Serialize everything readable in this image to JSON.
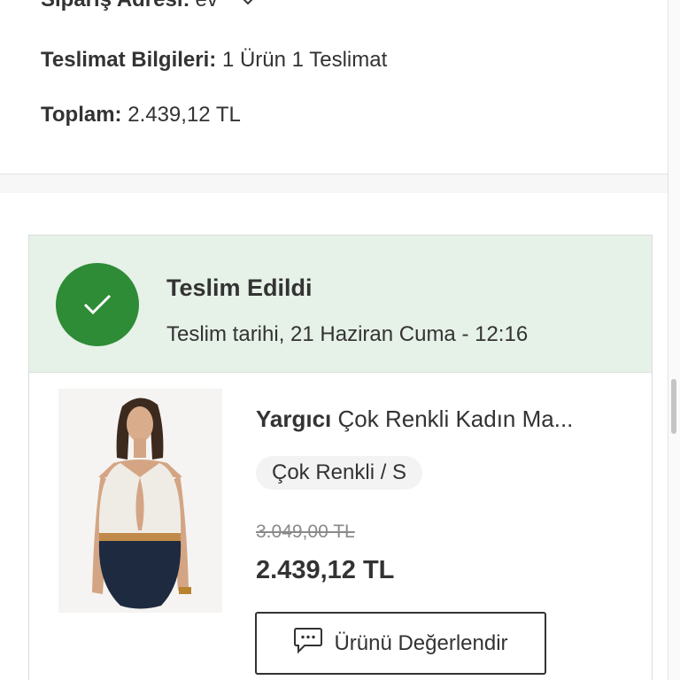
{
  "summary": {
    "address_label": "Sipariş Adresi:",
    "address_value": "ev",
    "address_toggle_icon": "chevron-down-icon",
    "delivery_label": "Teslimat Bilgileri:",
    "delivery_value": "1 Ürün 1 Teslimat",
    "total_label": "Toplam:",
    "total_value": "2.439,12 TL"
  },
  "shipment": {
    "status_icon": "check-icon",
    "status_color": "#2e8b36",
    "header_bg": "#e6f1e8",
    "status_title": "Teslim Edildi",
    "delivery_date": "Teslim tarihi, 21 Haziran Cuma - 12:16",
    "product": {
      "image": "product-swimsuit-image",
      "brand": "Yargıcı",
      "name": "Çok Renkli Kadın Ma...",
      "variant": "Çok Renkli / S",
      "old_price": "3.049,00 TL",
      "price": "2.439,12 TL",
      "review_button_icon": "chat-bubble-icon",
      "review_button_label": "Ürünü Değerlendir"
    }
  }
}
